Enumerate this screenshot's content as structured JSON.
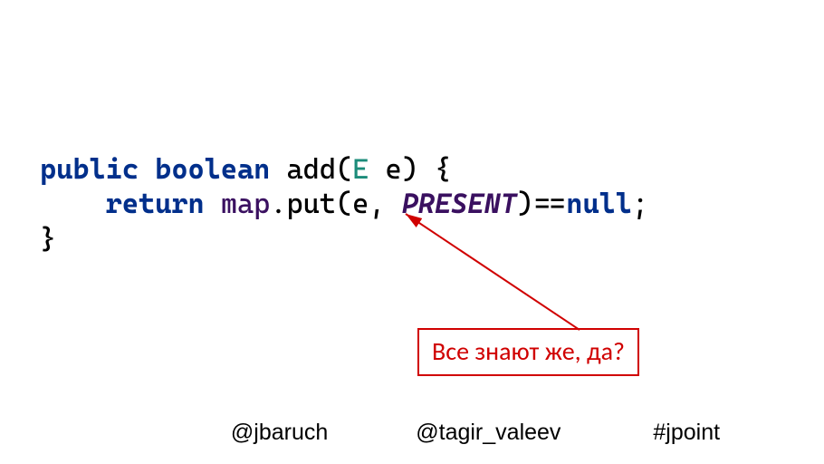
{
  "code": {
    "kw_public": "public",
    "kw_boolean": "boolean",
    "method": "add",
    "type_E": "E",
    "param": "e",
    "kw_return": "return",
    "field_map": "map",
    "call_put": ".put(e, ",
    "const_present": "PRESENT",
    "after_present": ")==",
    "kw_null": "null",
    "semi": ";",
    "open_paren": "(",
    "space": " ",
    "close_sig": ") {",
    "close_brace": "}",
    "indent": "    "
  },
  "callout": {
    "text": "Все знают же, да?"
  },
  "footer": {
    "handle1": "@jbaruch",
    "handle2": "@tagir_valeev",
    "hashtag": "#jpoint"
  },
  "colors": {
    "keyword": "#002f8b",
    "type": "#1c8c7a",
    "field": "#3a1060",
    "accent_red": "#d00000"
  }
}
